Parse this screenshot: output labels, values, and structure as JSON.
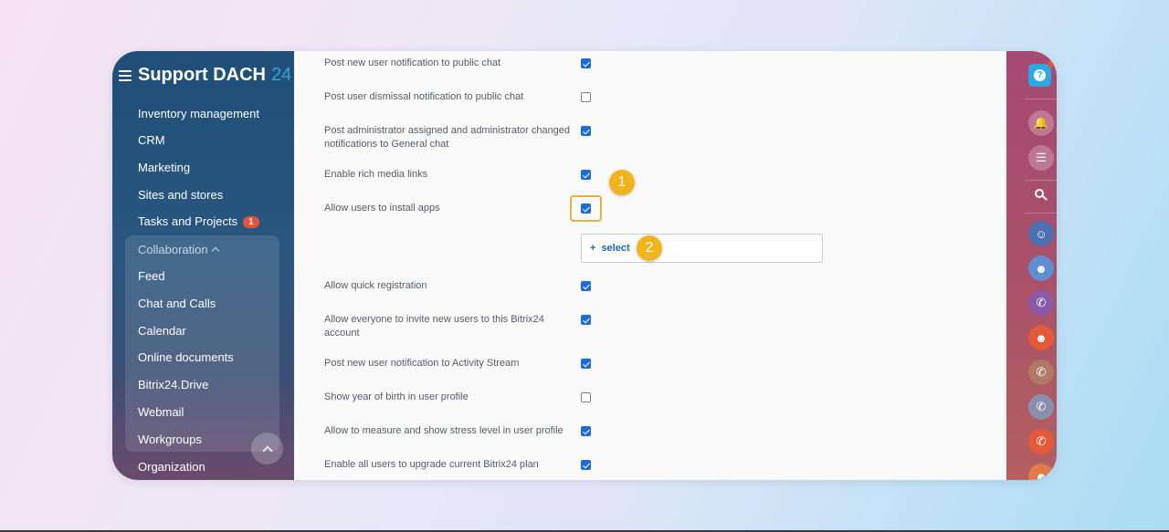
{
  "sidebar": {
    "brand_title": "Support DACH",
    "brand_num": "24",
    "items": [
      {
        "label": "Inventory management"
      },
      {
        "label": "CRM"
      },
      {
        "label": "Marketing"
      },
      {
        "label": "Sites and stores"
      },
      {
        "label": "Tasks and Projects",
        "badge": "1"
      }
    ],
    "collaboration": {
      "label": "Collaboration",
      "items": [
        {
          "label": "Feed"
        },
        {
          "label": "Chat and Calls"
        },
        {
          "label": "Calendar"
        },
        {
          "label": "Online documents"
        },
        {
          "label": "Bitrix24.Drive"
        },
        {
          "label": "Webmail"
        },
        {
          "label": "Workgroups"
        }
      ]
    },
    "bottom_item": "Organization"
  },
  "settings": [
    {
      "label": "Post new user notification to public chat",
      "checked": true
    },
    {
      "label": "Post user dismissal notification to public chat",
      "checked": false
    },
    {
      "label": "Post administrator assigned and administrator changed notifications to General chat",
      "checked": true
    },
    {
      "label": "Enable rich media links",
      "checked": true
    },
    {
      "label": "Allow users to install apps",
      "checked": true
    },
    {
      "label": "Allow quick registration",
      "checked": true
    },
    {
      "label": "Allow everyone to invite new users to this Bitrix24 account",
      "checked": true
    },
    {
      "label": "Post new user notification to Activity Stream",
      "checked": true
    },
    {
      "label": "Show year of birth in user profile",
      "checked": false
    },
    {
      "label": "Allow to measure and show stress level in user profile",
      "checked": true
    },
    {
      "label": "Enable all users to upgrade current Bitrix24 plan",
      "checked": true
    }
  ],
  "select_control": {
    "plus": "+",
    "label": "select"
  },
  "annotations": {
    "step1": "1",
    "step2": "2",
    "color": "#f2b41c"
  },
  "rightbar": {
    "help_label": "?"
  }
}
